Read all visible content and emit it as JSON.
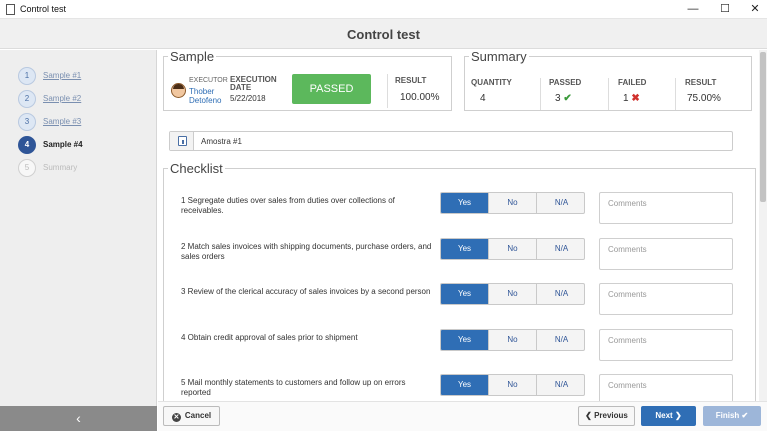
{
  "window": {
    "title": "Control test",
    "minimize": "—",
    "maximize": "☐",
    "close": "✕"
  },
  "header": {
    "title": "Control test"
  },
  "steps": [
    {
      "num": "1",
      "label": "Sample #1"
    },
    {
      "num": "2",
      "label": "Sample #2"
    },
    {
      "num": "3",
      "label": "Sample #3"
    },
    {
      "num": "4",
      "label": "Sample #4"
    },
    {
      "num": "5",
      "label": "Summary"
    }
  ],
  "collapse_icon": "‹",
  "sample": {
    "legend": "Sample",
    "executor_label": "EXECUTOR",
    "executor_name": "Thober Detofeno",
    "exec_date_label": "EXECUTION DATE",
    "exec_date": "5/22/2018",
    "status": "PASSED",
    "result_label": "RESULT",
    "result_value": "100.00%"
  },
  "summary": {
    "legend": "Summary",
    "quantity_label": "QUANTITY",
    "quantity": "4",
    "passed_label": "PASSED",
    "passed": "3",
    "failed_label": "FAILED",
    "failed": "1",
    "result_label": "RESULT",
    "result": "75.00%"
  },
  "sample_select": {
    "value": "Amostra #1"
  },
  "checklist": {
    "legend": "Checklist",
    "options": [
      "Yes",
      "No",
      "N/A"
    ],
    "comment_placeholder": "Comments",
    "items": [
      {
        "text": "1 Segregate duties over sales from duties over collections of receivables.",
        "selected": "Yes"
      },
      {
        "text": "2 Match sales invoices with shipping documents, purchase orders, and sales orders",
        "selected": "Yes"
      },
      {
        "text": "3 Review of the clerical accuracy of sales invoices by a second person",
        "selected": "Yes"
      },
      {
        "text": "4 Obtain credit approval of sales prior to shipment",
        "selected": "Yes"
      },
      {
        "text": "5 Mail monthly statements to customers and follow up on errors reported",
        "selected": "Yes"
      }
    ]
  },
  "footer": {
    "cancel": "Cancel",
    "previous": "Previous",
    "next": "Next",
    "finish": "Finish"
  }
}
